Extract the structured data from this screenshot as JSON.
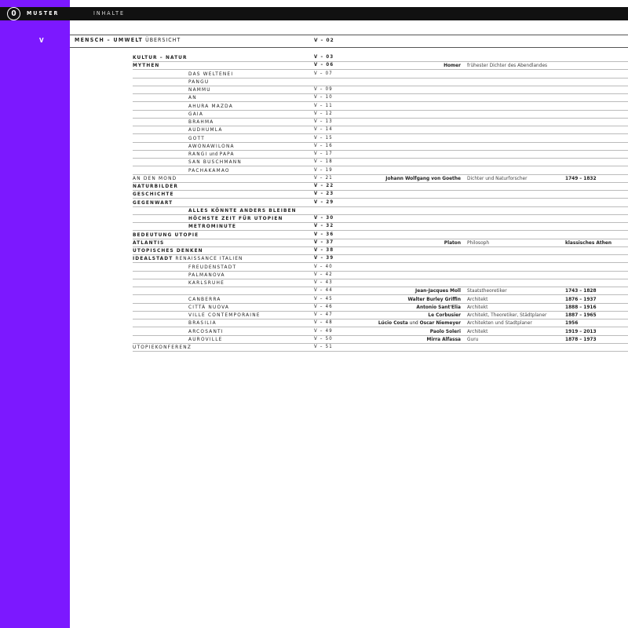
{
  "header": {
    "circle_num": "0",
    "label": "MUSTER",
    "section": "INHALTE"
  },
  "section": {
    "letter": "V",
    "title_bold": "MENSCH – UMWELT",
    "title_rest": " ÜBERSICHT",
    "page": "V – 02"
  },
  "toc": [
    {
      "label": "KULTUR – NATUR",
      "page": "V – 03",
      "bold": true,
      "indent": 0
    },
    {
      "label": "MYTHEN",
      "page": "V – 06",
      "bold": true,
      "indent": 0
    },
    {
      "label": "DAS WELTENEI",
      "page": "V – 07",
      "bold": false,
      "indent": 1
    },
    {
      "label": "PANGU",
      "page": "",
      "bold": false,
      "indent": 1
    },
    {
      "label": "NAMMU",
      "page": "V – 09",
      "bold": false,
      "indent": 1
    },
    {
      "label": "AN",
      "page": "V – 10",
      "bold": false,
      "indent": 1
    },
    {
      "label": "AHURA MAZDA",
      "page": "V – 11",
      "bold": false,
      "indent": 1
    },
    {
      "label": "GAIA",
      "page": "V – 12",
      "bold": false,
      "indent": 1
    },
    {
      "label": "BRAHMA",
      "page": "V – 13",
      "bold": false,
      "indent": 1
    },
    {
      "label": "AUDHUMLA",
      "page": "V – 14",
      "bold": false,
      "indent": 1
    },
    {
      "label": "GOTT",
      "page": "V – 15",
      "bold": false,
      "indent": 1
    },
    {
      "label": "AWONAWILONA",
      "page": "V – 16",
      "bold": false,
      "indent": 1
    },
    {
      "label": "RANGI",
      "label_small": "und",
      "label_after": "PAPA",
      "page": "V – 17",
      "bold": false,
      "indent": 1
    },
    {
      "label": "SAN BUSCHMANN",
      "page": "V – 18",
      "bold": false,
      "indent": 1
    },
    {
      "label": "PACHAKAMAO",
      "page": "V – 19",
      "bold": false,
      "indent": 1
    },
    {
      "label": "AN DEN MOND",
      "page": "V – 21",
      "bold": false,
      "indent": 0
    },
    {
      "label": "NATURBILDER",
      "page": "V – 22",
      "bold": true,
      "indent": 0
    },
    {
      "label": "GESCHICHTE",
      "page": "V – 23",
      "bold": true,
      "indent": 0
    },
    {
      "label": "GEGENWART",
      "page": "V – 29",
      "bold": true,
      "indent": 0
    },
    {
      "label": "ALLES KÖNNTE ANDERS BLEIBEN",
      "page": "",
      "bold": true,
      "indent": 1
    },
    {
      "label": "HÖCHSTE ZEIT FÜR UTOPIEN",
      "page": "V – 30",
      "bold": true,
      "indent": 1
    },
    {
      "label": "METROMINUTE",
      "page": "V – 32",
      "bold": true,
      "indent": 1
    },
    {
      "label": "BEDEUTUNG UTOPIE",
      "page": "V – 36",
      "bold": true,
      "indent": 0
    },
    {
      "label": "ATLANTIS",
      "page": "V – 37",
      "bold": true,
      "indent": 0
    },
    {
      "label": "UTOPISCHES DENKEN",
      "page": "V – 38",
      "bold": true,
      "indent": 0
    },
    {
      "label": "IDEALSTADT",
      "label_rest": " RENAISSANCE ITALIEN",
      "page": "V – 39",
      "bold": true,
      "indent": 0
    },
    {
      "label": "FREUDENSTADT",
      "page": "V – 40",
      "bold": false,
      "indent": 1
    },
    {
      "label": "PALMANOVA",
      "page": "V – 42",
      "bold": false,
      "indent": 1
    },
    {
      "label": "KARLSRUHE",
      "page": "V – 43",
      "bold": false,
      "indent": 1
    },
    {
      "label": "",
      "page": "V – 44",
      "bold": false,
      "indent": 1
    },
    {
      "label": "CANBERRA",
      "page": "V – 45",
      "bold": false,
      "indent": 1
    },
    {
      "label": "CITTÀ NUOVA",
      "page": "V – 46",
      "bold": false,
      "indent": 1
    },
    {
      "label": "VILLE CONTEMPORAINE",
      "page": "V – 47",
      "bold": false,
      "indent": 1
    },
    {
      "label": "BRASILIA",
      "page": "V – 48",
      "bold": false,
      "indent": 1
    },
    {
      "label": "ARCOSANTI",
      "page": "V – 49",
      "bold": false,
      "indent": 1
    },
    {
      "label": "AUROVILLE",
      "page": "V – 50",
      "bold": false,
      "indent": 1
    },
    {
      "label": "UTOPIEKONFERENZ",
      "page": "V – 51",
      "bold": false,
      "indent": 0
    }
  ],
  "people": [
    {
      "row": 1,
      "name": "Homer",
      "desc": "frühester Dichter des Abendlandes",
      "years": ""
    },
    {
      "row": 15,
      "name": "Johann Wolfgang von Goethe",
      "desc": "Dichter und Naturforscher",
      "years": "1749 – 1832"
    },
    {
      "row": 23,
      "name": "Platon",
      "desc": "Philosoph",
      "years": "klassisches Athen"
    },
    {
      "row": 29,
      "name": "Jean-Jacques Moll",
      "desc": "Staatstheoretiker",
      "years": "1743 – 1828"
    },
    {
      "row": 30,
      "name": "Walter Burley Griffin",
      "desc": "Architekt",
      "years": "1876 – 1937"
    },
    {
      "row": 31,
      "name": "Antonio Sant'Elia",
      "desc": "Architekt",
      "years": "1888 – 1916"
    },
    {
      "row": 32,
      "name": "Le Corbusier",
      "desc": "Architekt, Theoretiker, Städtplaner",
      "years": "1887 – 1965"
    },
    {
      "row": 33,
      "name": "Lúcio Costa",
      "name_mid": " und ",
      "name_after": "Oscar Niemeyer",
      "desc": "Architekten und Stadtplaner",
      "years": "1956"
    },
    {
      "row": 34,
      "name": "Paolo Soleri",
      "desc": "Architekt",
      "years": "1919 – 2013"
    },
    {
      "row": 35,
      "name": "Mirra Alfassa",
      "desc": "Guru",
      "years": "1878 – 1973"
    }
  ]
}
